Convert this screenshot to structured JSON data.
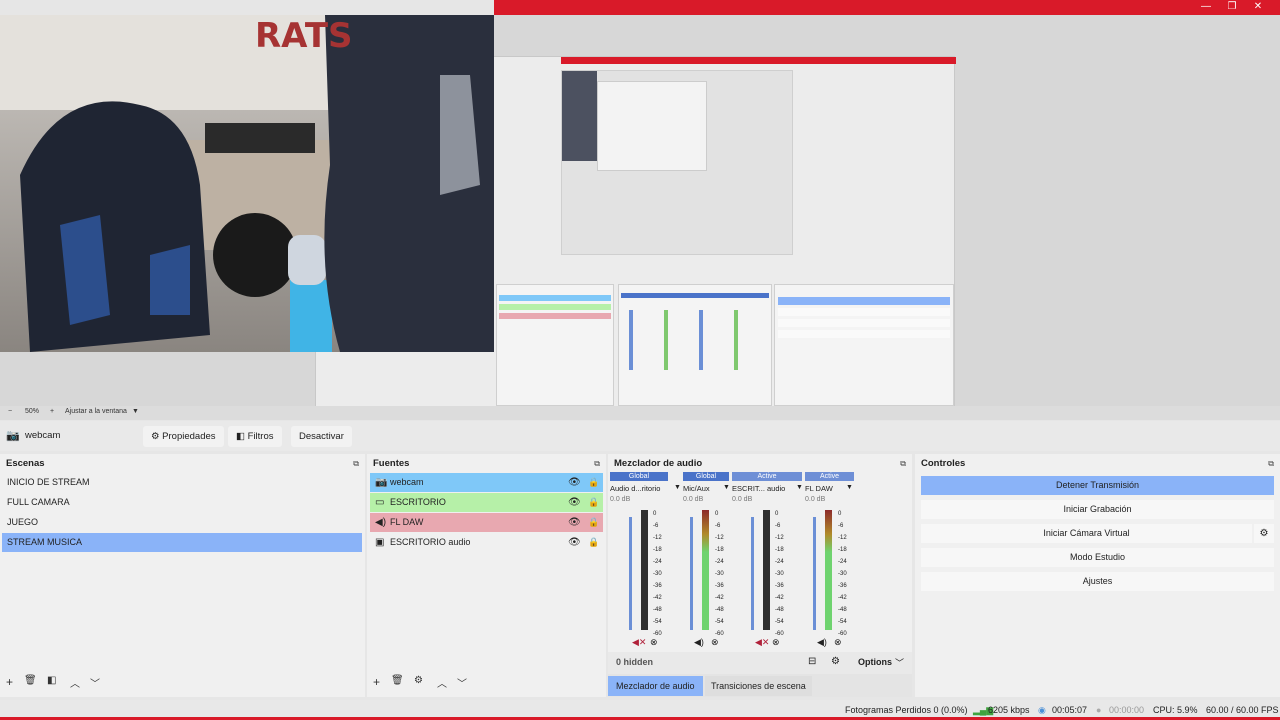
{
  "window": {
    "minimize": "—",
    "maximize": "❐",
    "close": "✕"
  },
  "zoom": {
    "minus": "−",
    "level": "50%",
    "plus": "+",
    "fit": "Ajustar a la ventana"
  },
  "source_toolbar": {
    "current_source": "webcam",
    "properties": "Propiedades",
    "filters": "Filtros",
    "deactivate": "Desactivar"
  },
  "scenes": {
    "title": "Escenas",
    "items": [
      "INICIO DE STREAM",
      "FULL CAMARA",
      "JUEGO",
      "STREAM MUSICA"
    ],
    "selected": "STREAM MUSICA"
  },
  "sources": {
    "title": "Fuentes",
    "items": [
      {
        "label": "webcam",
        "color": "#7fc8f8"
      },
      {
        "label": "ESCRITORIO",
        "color": "#b6f0a8"
      },
      {
        "label": "FL DAW",
        "color": "#e8a8b0"
      },
      {
        "label": "ESCRITORIO audio",
        "color": ""
      }
    ]
  },
  "mixer": {
    "title": "Mezclador de audio",
    "channels": [
      {
        "tag": "Global",
        "name": "Audio d...ritorio",
        "db": "0.0 dB",
        "tag_color": "#4a73c9"
      },
      {
        "tag": "Global",
        "name": "Mic/Aux",
        "db": "0.0 dB",
        "tag_color": "#4a73c9"
      },
      {
        "tag": "Active",
        "name": "ESCRIT... audio",
        "db": "0.0 dB",
        "tag_color": "#6e8fd6"
      },
      {
        "tag": "Active",
        "name": "FL DAW",
        "db": "0.0 dB",
        "tag_color": "#6e8fd6"
      }
    ],
    "scale": [
      "0",
      "-6",
      "-12",
      "-18",
      "-24",
      "-30",
      "-36",
      "-42",
      "-48",
      "-54",
      "-60"
    ],
    "hidden": "0 hidden",
    "options": "Options",
    "tab_mixer": "Mezclador de audio",
    "tab_transitions": "Transiciones de escena"
  },
  "controls": {
    "title": "Controles",
    "stop_stream": "Detener Transmisión",
    "start_recording": "Iniciar Grabación",
    "virtual_cam": "Iniciar Cámara Virtual",
    "studio_mode": "Modo Estudio",
    "settings": "Ajustes"
  },
  "status": {
    "dropped_frames": "Fotogramas Perdidos 0 (0.0%)",
    "bitrate": "6205 kbps",
    "stream_time": "00:05:07",
    "rec_time": "00:00:00",
    "cpu": "CPU: 5.9%",
    "fps": "60.00 / 60.00 FPS"
  },
  "colors": {
    "accent": "#d91a29",
    "selection": "#8ab3f8"
  }
}
